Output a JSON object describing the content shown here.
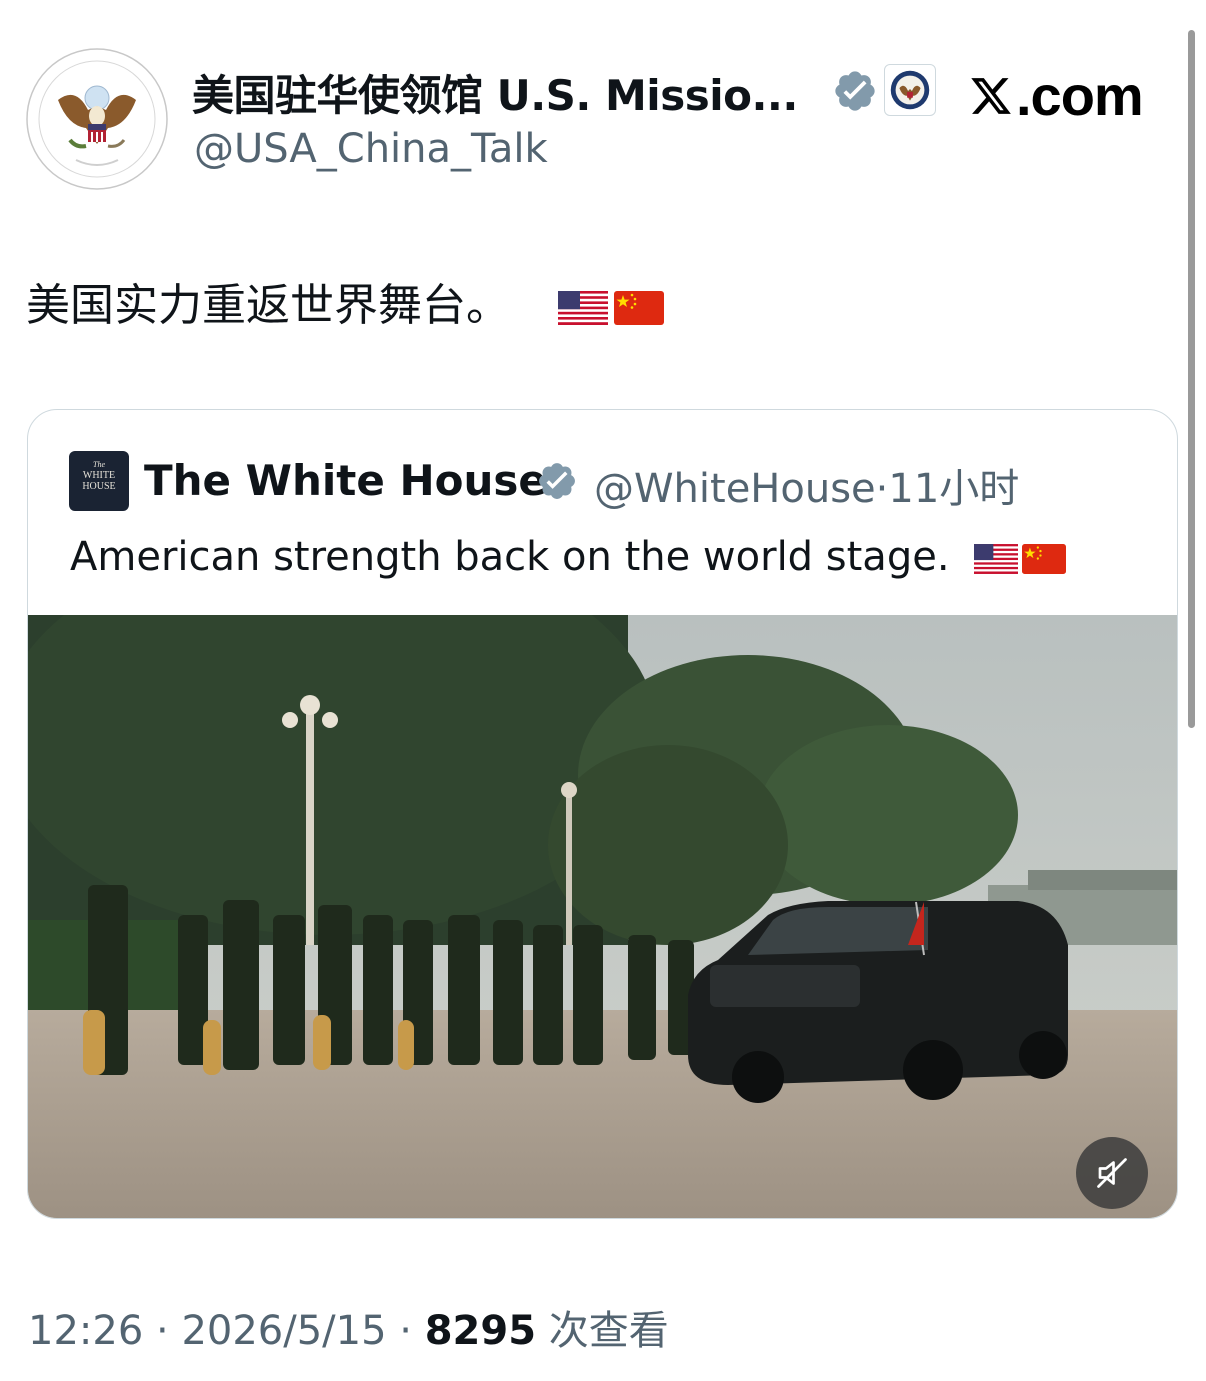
{
  "header": {
    "display_name": "美国驻华使领馆 U.S. Missio...",
    "handle": "@USA_China_Talk",
    "avatar_icon": "embassy-seal-icon",
    "verified_icon": "verified-badge-icon",
    "affiliation_icon": "state-department-seal-icon",
    "watermark_text": ".com",
    "watermark_icon": "x-logo-icon"
  },
  "tweet": {
    "text": "美国实力重返世界舞台。",
    "flag_icons": [
      "us-flag-icon",
      "china-flag-icon"
    ]
  },
  "quote": {
    "name": "The White House",
    "avatar_text_top": "The",
    "avatar_text_mid": "WHITE",
    "avatar_text_bottom": "HOUSE",
    "handle": "@WhiteHouse",
    "separator": "·",
    "time": "11小时",
    "text": "American strength back on the world stage.",
    "media_icon": "video-thumbnail",
    "mute_icon": "muted-speaker-icon"
  },
  "footer": {
    "time": "12:26",
    "sep1": " · ",
    "date": "2026/5/15",
    "sep2": " · ",
    "views": "8295",
    "views_label": " 次查看"
  },
  "colors": {
    "text_primary": "#0f1419",
    "text_secondary": "#536471",
    "border": "#cfd9de",
    "verified_grey": "#829aab",
    "verified_blue": "#1d9bf0"
  }
}
